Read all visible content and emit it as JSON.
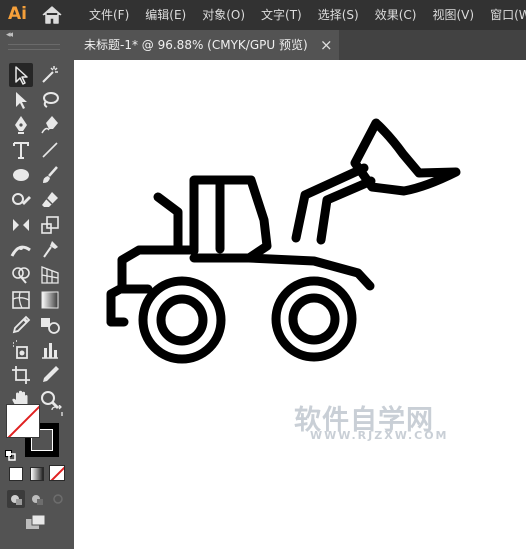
{
  "app": {
    "logo_text": "Ai",
    "logo_color": "#f6a03a"
  },
  "menubar": {
    "items": [
      "文件(F)",
      "编辑(E)",
      "对象(O)",
      "文字(T)",
      "选择(S)",
      "效果(C)",
      "视图(V)",
      "窗口(W)"
    ]
  },
  "document_tab": {
    "title": "未标题-1* @ 96.88% (CMYK/GPU 预览)",
    "close_glyph": "×",
    "zoom_percent": 96.88
  },
  "toolbar": {
    "collapse_glyph": "◂◂",
    "tools": [
      "selection-tool",
      "magic-wand-tool",
      "direct-selection-tool",
      "lasso-tool",
      "pen-tool",
      "curvature-tool",
      "type-tool",
      "line-segment-tool",
      "ellipse-tool",
      "paintbrush-tool",
      "shaper-tool",
      "eraser-tool",
      "rotate-tool",
      "scale-tool",
      "width-tool",
      "puppet-warp-tool",
      "shape-builder-tool",
      "perspective-grid-tool",
      "mesh-tool",
      "gradient-tool",
      "eyedropper-tool",
      "blend-tool",
      "symbol-sprayer-tool",
      "column-graph-tool",
      "artboard-tool",
      "slice-tool",
      "hand-tool",
      "zoom-tool"
    ],
    "selected_tool": "selection-tool",
    "fill_color": "#ffffff",
    "stroke_color": "#000000"
  },
  "watermark": {
    "line1": "软件自学网",
    "line2": "WWW.RJZXW.COM"
  },
  "colors": {
    "menubar_bg": "#323232",
    "panel_bg": "#535353",
    "canvas_bg": "#ffffff",
    "accent_none": "#e02020"
  }
}
